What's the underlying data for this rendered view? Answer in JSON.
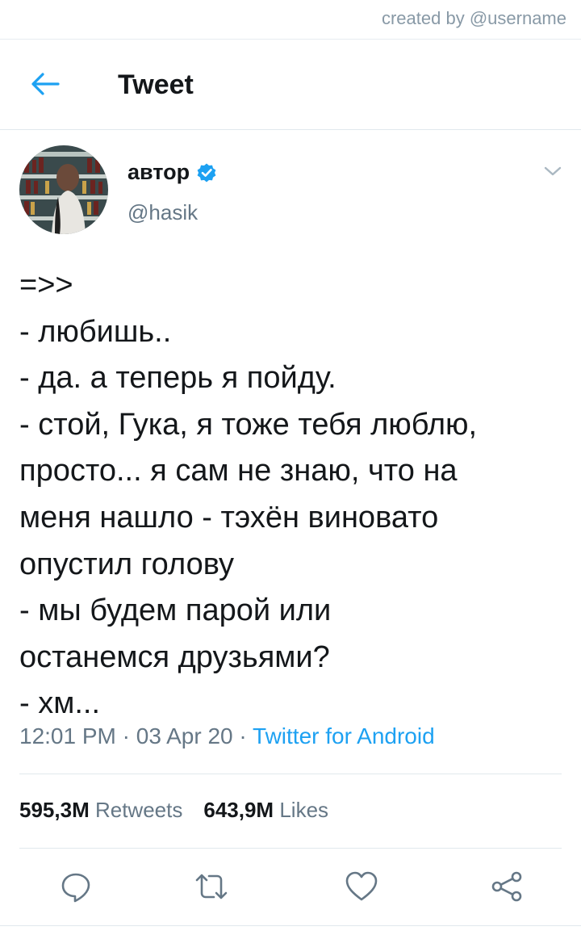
{
  "watermark": "created by @username",
  "header": {
    "title": "Tweet",
    "back_icon": "arrow-left-icon"
  },
  "author": {
    "name": "автор",
    "handle": "@hasik",
    "verified_icon": "verified-badge-icon",
    "avatar_icon": "avatar-photo"
  },
  "tweet": {
    "lines": [
      "=>>",
      "- любишь..",
      "- да. а теперь я пойду.",
      "- стой, Гука, я тоже тебя люблю,",
      "просто... я сам не знаю, что на",
      "меня нашло - тэхён виновато",
      "опустил голову",
      "- мы будем парой или",
      "останемся друзьями?",
      "- хм..."
    ]
  },
  "meta": {
    "time": "12:01 PM",
    "sep1": " · ",
    "date": "03 Apr 20",
    "sep2": " · ",
    "source": "Twitter for Android"
  },
  "stats": {
    "retweets_count": "595,3M",
    "retweets_label": "Retweets",
    "likes_count": "643,9M",
    "likes_label": "Likes"
  },
  "actions": [
    "reply-icon",
    "retweet-icon",
    "like-icon",
    "share-icon"
  ],
  "colors": {
    "accent": "#1da1f2",
    "text": "#14171a",
    "secondary": "#657786",
    "divider": "#e1e8ed"
  }
}
